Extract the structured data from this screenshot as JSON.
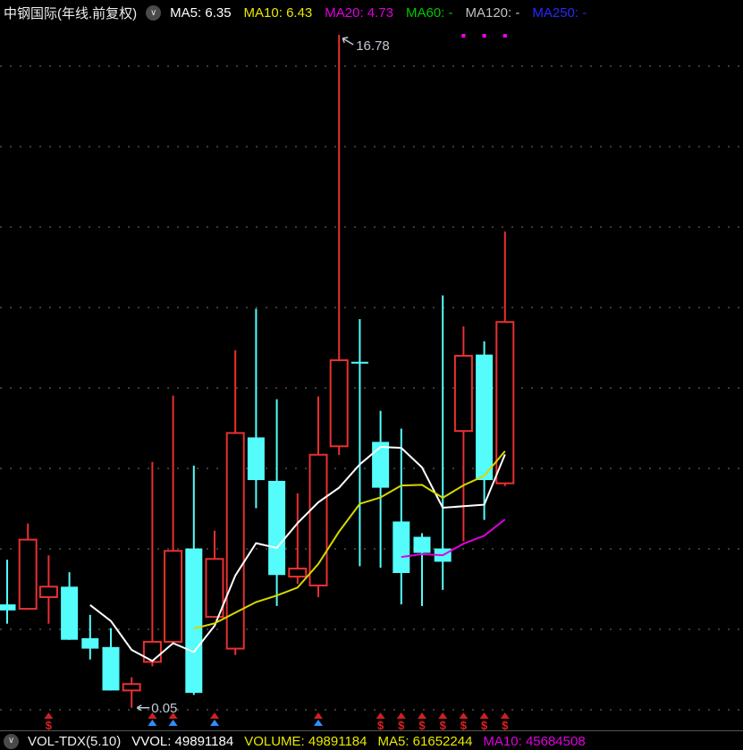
{
  "top_bar": {
    "title": "中钢国际(年线.前复权)",
    "dropdown_icon": "chevron-down",
    "ma_labels": [
      {
        "text": "MA5: 6.35",
        "color": "#ffffff"
      },
      {
        "text": "MA10: 6.43",
        "color": "#e8e800"
      },
      {
        "text": "MA20: 4.73",
        "color": "#e000e0"
      },
      {
        "text": "MA60: -",
        "color": "#00c800"
      },
      {
        "text": "MA120: -",
        "color": "#c0c0c0"
      },
      {
        "text": "MA250: -",
        "color": "#2828ff"
      }
    ]
  },
  "bottom_bar": {
    "dropdown_icon": "chevron-down",
    "indicator": "VOL-TDX(5.10)",
    "fields": [
      {
        "text": "VVOL: 49891184",
        "color": "#ffffff"
      },
      {
        "text": "VOLUME: 49891184",
        "color": "#e8e800"
      },
      {
        "text": "MA5: 61652244",
        "color": "#e8e800"
      },
      {
        "text": "MA10: 45684508",
        "color": "#e000e0"
      }
    ]
  },
  "chart_data": {
    "type": "candlestick",
    "instrument": "中钢国际",
    "period": "年线",
    "adjustment": "前复权",
    "grid": "dotted horizontal lines",
    "price_gridlines": [
      16,
      14,
      12,
      10,
      8,
      6,
      4,
      2,
      0
    ],
    "ylim": [
      0,
      16.78
    ],
    "ma_overlays": [
      {
        "period": 5,
        "color": "#ffffff"
      },
      {
        "period": 10,
        "color": "#d8d800"
      },
      {
        "period": 20,
        "color": "#e000e0"
      }
    ],
    "colors": {
      "up": "#e83030",
      "down": "#54fcfc",
      "marker_dollar": "#e02020",
      "marker_triangle_red": "#d02020",
      "marker_triangle_blue": "#2e8fff",
      "grid": "#3a3a3a",
      "annotation": "#c0c8d4"
    },
    "candles": [
      {
        "o": 2.62,
        "h": 3.73,
        "l": 2.14,
        "c": 2.47
      },
      {
        "o": 2.51,
        "h": 4.63,
        "l": 2.51,
        "c": 4.23
      },
      {
        "o": 2.8,
        "h": 3.84,
        "l": 2.14,
        "c": 3.06
      },
      {
        "o": 3.06,
        "h": 3.42,
        "l": 1.74,
        "c": 1.74
      },
      {
        "o": 1.78,
        "h": 2.36,
        "l": 1.25,
        "c": 1.52
      },
      {
        "o": 1.56,
        "h": 2.03,
        "l": 0.48,
        "c": 0.48
      },
      {
        "o": 0.48,
        "h": 0.81,
        "l": 0.05,
        "c": 0.64
      },
      {
        "o": 1.19,
        "h": 6.16,
        "l": 1.08,
        "c": 1.69
      },
      {
        "o": 1.69,
        "h": 7.81,
        "l": 1.69,
        "c": 3.95
      },
      {
        "o": 4.01,
        "h": 6.07,
        "l": 0.37,
        "c": 0.42
      },
      {
        "o": 2.31,
        "h": 4.45,
        "l": 2.29,
        "c": 3.75
      },
      {
        "o": 1.52,
        "h": 8.94,
        "l": 1.36,
        "c": 6.88
      },
      {
        "o": 6.77,
        "h": 9.97,
        "l": 5.01,
        "c": 5.71
      },
      {
        "o": 5.69,
        "h": 7.72,
        "l": 2.58,
        "c": 3.35
      },
      {
        "o": 3.31,
        "h": 5.38,
        "l": 3.13,
        "c": 3.51
      },
      {
        "o": 3.09,
        "h": 7.79,
        "l": 2.8,
        "c": 6.34
      },
      {
        "o": 6.55,
        "h": 16.78,
        "l": 6.33,
        "c": 8.69
      },
      {
        "o": 8.65,
        "h": 9.71,
        "l": 3.57,
        "c": 8.61
      },
      {
        "o": 6.66,
        "h": 7.43,
        "l": 3.53,
        "c": 5.52
      },
      {
        "o": 4.68,
        "h": 6.99,
        "l": 2.62,
        "c": 3.4
      },
      {
        "o": 4.3,
        "h": 4.39,
        "l": 2.58,
        "c": 3.9
      },
      {
        "o": 4.01,
        "h": 10.3,
        "l": 2.98,
        "c": 3.68
      },
      {
        "o": 6.93,
        "h": 9.53,
        "l": 4.19,
        "c": 8.8
      },
      {
        "o": 8.83,
        "h": 9.16,
        "l": 4.72,
        "c": 5.71
      },
      {
        "o": 5.63,
        "h": 11.89,
        "l": 5.56,
        "c": 9.64
      }
    ],
    "event_markers": [
      {
        "candle": 2,
        "type": "dollar"
      },
      {
        "candle": 7,
        "type": "triangles"
      },
      {
        "candle": 8,
        "type": "triangles"
      },
      {
        "candle": 10,
        "type": "triangles"
      },
      {
        "candle": 15,
        "type": "triangles"
      },
      {
        "candle": 18,
        "type": "dollar"
      },
      {
        "candle": 19,
        "type": "dollar"
      },
      {
        "candle": 20,
        "type": "dollar"
      },
      {
        "candle": 21,
        "type": "dollar"
      },
      {
        "candle": 22,
        "type": "dollar"
      },
      {
        "candle": 23,
        "type": "dollar"
      },
      {
        "candle": 24,
        "type": "dollar"
      }
    ],
    "annotations": {
      "high": {
        "text": "16.78",
        "value": 16.78,
        "candle": 16
      },
      "low": {
        "text": "0.05",
        "value": 0.05,
        "candle": 6
      }
    },
    "top_dots": {
      "color": "#ff00ff",
      "y": 38,
      "candle_indices": [
        22,
        23,
        24
      ]
    }
  }
}
